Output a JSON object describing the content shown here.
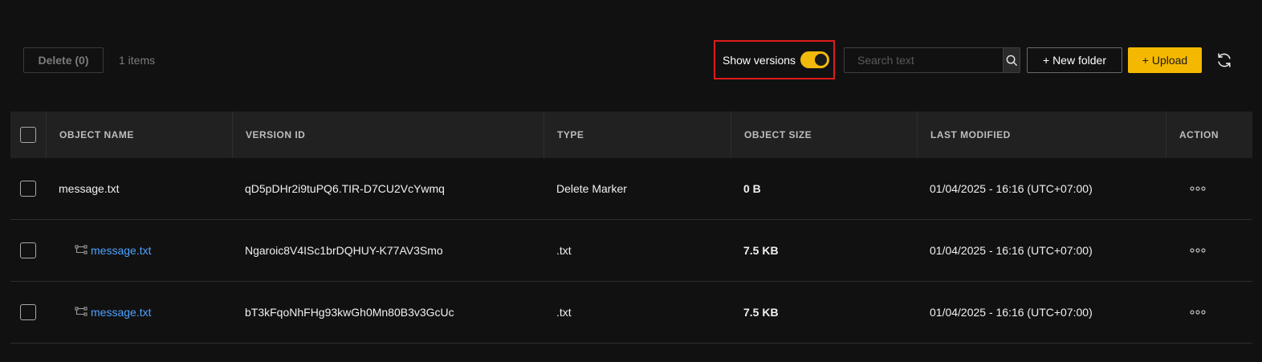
{
  "toolbar": {
    "delete_label": "Delete (0)",
    "items_count": "1 items",
    "show_versions_label": "Show versions",
    "show_versions_on": true,
    "search_placeholder": "Search text",
    "new_folder_label": "+ New folder",
    "upload_label": "+ Upload"
  },
  "colors": {
    "accent": "#f5b800",
    "link": "#4aa3ff",
    "highlight_border": "#e01b1b"
  },
  "table": {
    "headers": [
      "OBJECT NAME",
      "VERSION ID",
      "TYPE",
      "OBJECT SIZE",
      "LAST MODIFIED",
      "ACTION"
    ],
    "rows": [
      {
        "name": "message.txt",
        "version_id": "qD5pDHr2i9tuPQ6.TIR-D7CU2VcYwmq",
        "type": "Delete Marker",
        "size": "0 B",
        "modified": "01/04/2025 - 16:16 (UTC+07:00)"
      },
      {
        "name": "message.txt",
        "version_id": "Ngaroic8V4ISc1brDQHUY-K77AV3Smo",
        "type": ".txt",
        "size": "7.5 KB",
        "modified": "01/04/2025 - 16:16 (UTC+07:00)"
      },
      {
        "name": "message.txt",
        "version_id": "bT3kFqoNhFHg93kwGh0Mn80B3v3GcUc",
        "type": ".txt",
        "size": "7.5 KB",
        "modified": "01/04/2025 - 16:16 (UTC+07:00)"
      }
    ]
  }
}
